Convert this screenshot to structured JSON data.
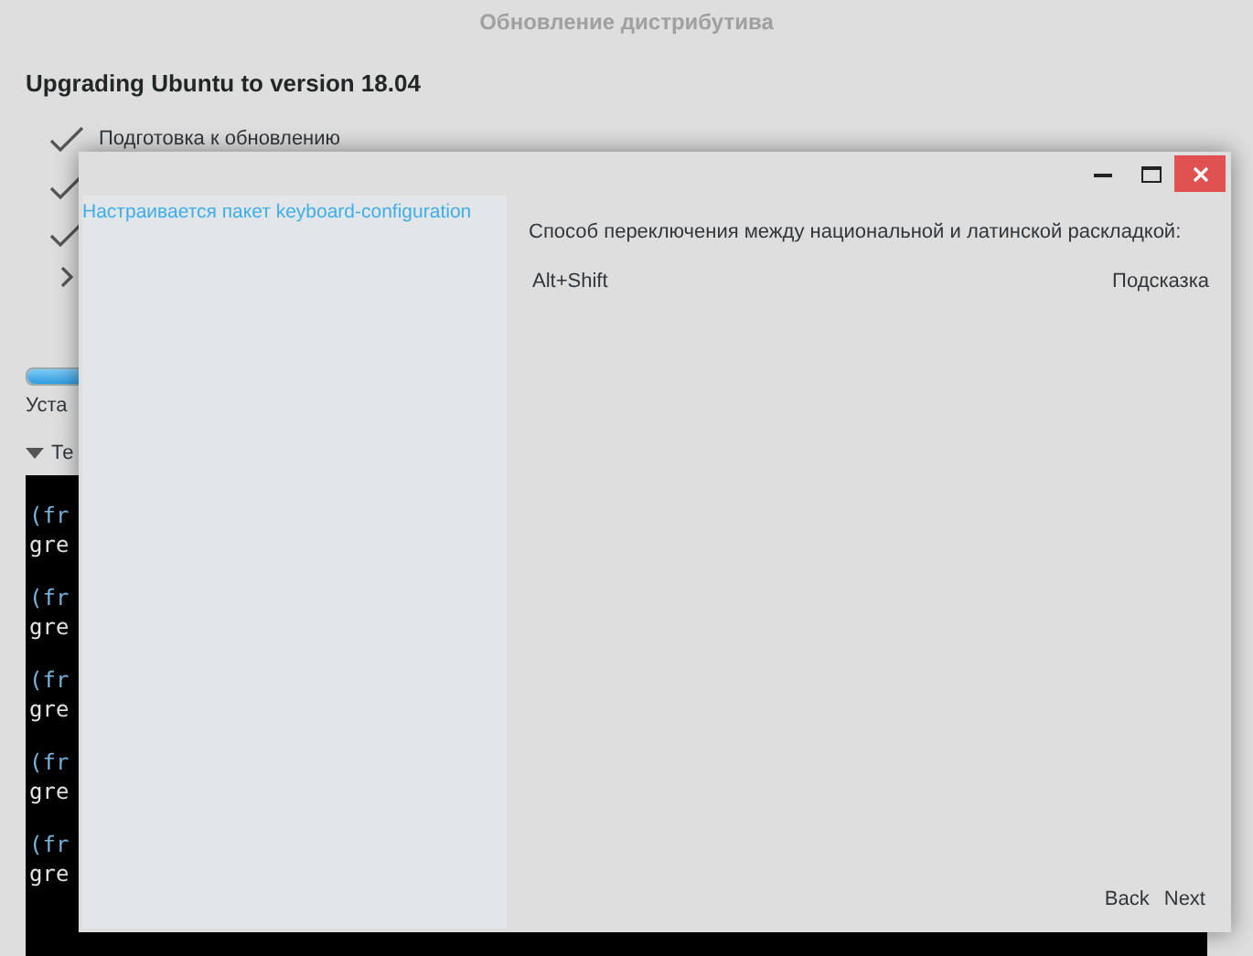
{
  "background_window": {
    "title": "Обновление дистрибутива",
    "heading": "Upgrading Ubuntu to version 18.04",
    "steps": [
      {
        "label": "Подготовка к обновлению",
        "done": true
      },
      {
        "done": true
      },
      {
        "done": true
      },
      {
        "done": false
      }
    ],
    "progress": {
      "level": 0.05
    },
    "status": "Уста",
    "terminal_toggle": {
      "label": "Те",
      "expanded": true
    },
    "terminal_lines": [
      "(fr",
      "gre",
      "(fr",
      "gre",
      "(fr",
      "gre",
      "(fr",
      "gre",
      "(fr",
      "gre"
    ]
  },
  "dialog": {
    "sidebar_text": "Настраивается пакет keyboard-configuration",
    "question": "Способ переключения между национальной и латинской раскладкой:",
    "value": "Alt+Shift",
    "hint": "Подсказка",
    "buttons": [
      "Back",
      "Next"
    ]
  }
}
